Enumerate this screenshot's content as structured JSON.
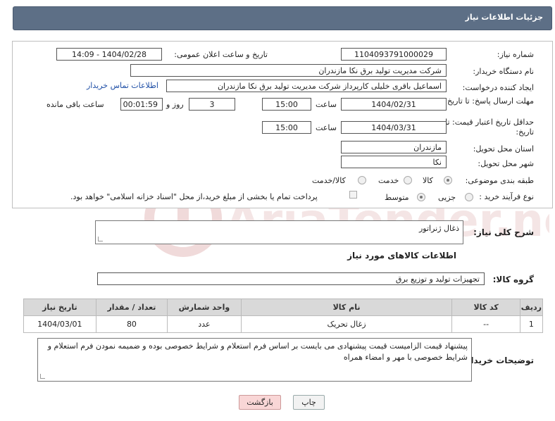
{
  "header": {
    "title": "جزئیات اطلاعات نیاز"
  },
  "form": {
    "need_number_label": "شماره نیاز:",
    "need_number": "1104093791000029",
    "announce_label": "تاریخ و ساعت اعلان عمومی:",
    "announce_value": "1404/02/28 - 14:09",
    "buyer_org_label": "نام دستگاه خریدار:",
    "buyer_org": "شرکت مدیریت تولید برق نکا  مازندران",
    "creator_label": "ایجاد کننده درخواست:",
    "creator": "اسماعیل باقری خلیلی کارپرداز شرکت مدیریت تولید برق نکا  مازندران",
    "contact_link": "اطلاعات تماس خریدار",
    "reply_deadline_label": "مهلت ارسال پاسخ: تا تاریخ:",
    "reply_date": "1404/02/31",
    "hour_label": "ساعت",
    "reply_time": "15:00",
    "days_value": "3",
    "days_label": "روز و",
    "remaining_time": "00:01:59",
    "remaining_label": "ساعت باقی مانده",
    "price_validity_label": "حداقل تاریخ اعتبار قیمت: تا تاریخ:",
    "price_date": "1404/03/31",
    "price_time": "15:00",
    "province_label": "استان محل تحویل:",
    "province": "مازندران",
    "city_label": "شهر محل تحویل:",
    "city": "نکا",
    "category_label": "طبقه بندی موضوعی:",
    "category_options": [
      "کالا",
      "خدمت",
      "کالا/خدمت"
    ],
    "process_label": "نوع فرآیند خرید :",
    "process_options": [
      "جزیی",
      "متوسط"
    ],
    "payment_note": "پرداخت تمام یا بخشی از مبلغ خرید،از محل \"اسناد خزانه اسلامی\" خواهد بود."
  },
  "summary": {
    "label": "شرح کلی نیاز:",
    "value": "ذغال ژنراتور"
  },
  "goods_section_title": "اطلاعات کالاهای مورد نیاز",
  "goods_group": {
    "label": "گروه کالا:",
    "value": "تجهیزات تولید و توزیع برق"
  },
  "table": {
    "headers": [
      "ردیف",
      "کد کالا",
      "نام کالا",
      "واحد شمارش",
      "تعداد / مقدار",
      "تاریخ نیاز"
    ],
    "rows": [
      [
        "1",
        "--",
        "زغال تحریک",
        "عدد",
        "80",
        "1404/03/01"
      ]
    ]
  },
  "buyer_notes": {
    "label": "توضیحات خریدار:",
    "value": "پیشنهاد قیمت الزامیست قیمت پیشنهادی می بایست بر اساس فرم استعلام و شرایط خصوصی بوده و ضمیمه نمودن فرم استعلام و شرایط خصوصی با مهر و امضاء همراه"
  },
  "buttons": {
    "print": "چاپ",
    "back": "بازگشت"
  },
  "watermark_text": "AriaTender.neT",
  "colors": {
    "header_bg": "#5d6f86",
    "link": "#1f4fa6",
    "back_btn_bg": "#f9d6d6",
    "watermark": "#e9c9c9"
  }
}
